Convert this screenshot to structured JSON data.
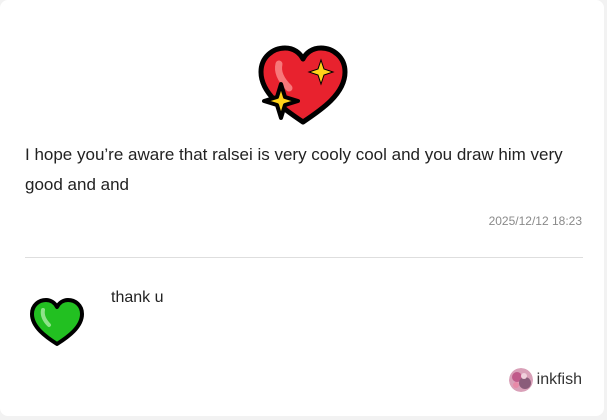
{
  "question": {
    "icon": "sparkling-heart-icon",
    "text": "I hope you’re aware that ralsei is very cooly cool and you draw him very good and and",
    "timestamp": "2025/12/12 18:23"
  },
  "answer": {
    "icon": "green-heart-icon",
    "text": "thank u",
    "author": "inkfish"
  },
  "colors": {
    "red_heart": "#e8222e",
    "green_heart": "#22c021",
    "sparkle": "#ffd21a",
    "outline": "#000000",
    "divider": "#dedede",
    "timestamp": "#8a8a8a"
  }
}
